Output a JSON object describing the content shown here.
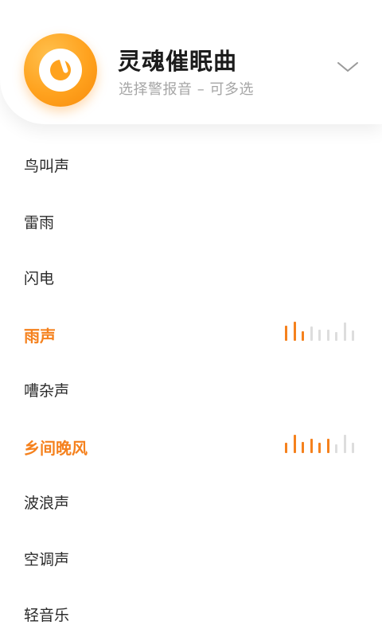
{
  "header": {
    "title": "灵魂催眠曲",
    "subtitle": "选择警报音 – 可多选",
    "logo_icon": "music-disc-icon",
    "dropdown_icon": "chevron-down-icon"
  },
  "colors": {
    "accent": "#f5811d",
    "bar_inactive": "#dddddd"
  },
  "sounds": [
    {
      "label": "鸟叫声",
      "active": false
    },
    {
      "label": "雷雨",
      "active": false
    },
    {
      "label": "闪电",
      "active": false
    },
    {
      "label": "雨声",
      "active": true,
      "levels": [
        0.8,
        1.0,
        0.5,
        0.75,
        0.6,
        0.6,
        0.45,
        0.95,
        0.55
      ],
      "lit_bars": 3
    },
    {
      "label": "嘈杂声",
      "active": false
    },
    {
      "label": "乡间晚风",
      "active": true,
      "levels": [
        0.55,
        0.95,
        0.6,
        0.75,
        0.55,
        0.75,
        0.45,
        0.95,
        0.55
      ],
      "lit_bars": 6
    },
    {
      "label": "波浪声",
      "active": false
    },
    {
      "label": "空调声",
      "active": false
    },
    {
      "label": "轻音乐",
      "active": false
    }
  ]
}
